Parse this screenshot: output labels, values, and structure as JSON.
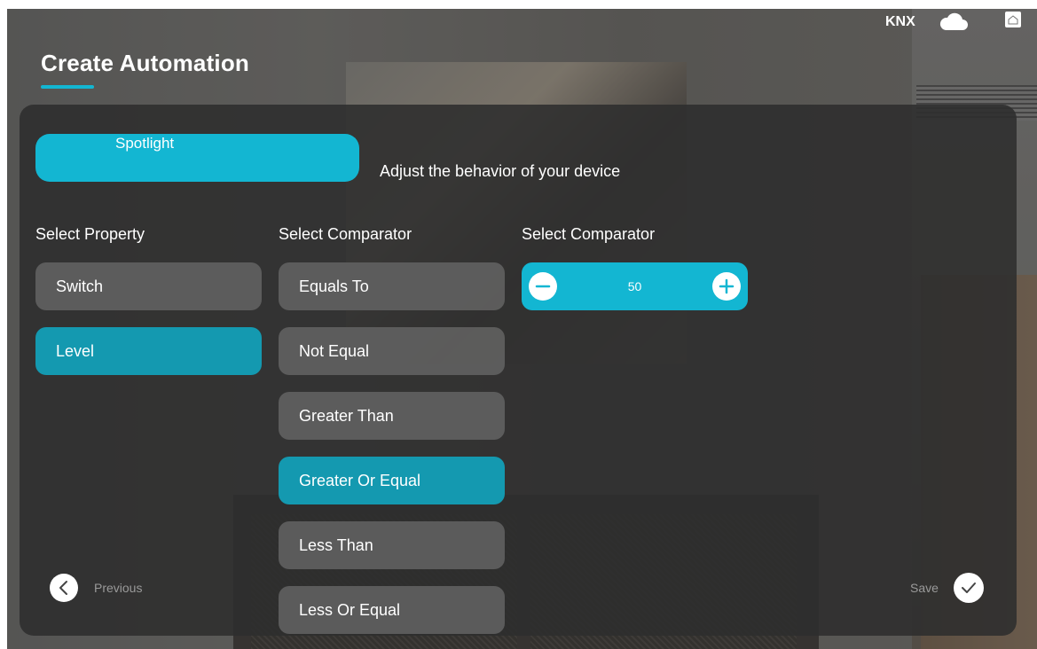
{
  "topbar": {
    "knx_label": "KNX",
    "icons": [
      "cloud-icon",
      "home-icon"
    ]
  },
  "page": {
    "title": "Create Automation"
  },
  "device": {
    "name": "Spotlight",
    "subtitle": "Adjust the behavior of your device"
  },
  "columns": {
    "property_label": "Select Property",
    "comparator_label": "Select Comparator",
    "value_label": "Select Comparator"
  },
  "properties": [
    {
      "label": "Switch",
      "selected": false
    },
    {
      "label": "Level",
      "selected": true
    }
  ],
  "comparators": [
    {
      "label": "Equals To",
      "selected": false
    },
    {
      "label": "Not Equal",
      "selected": false
    },
    {
      "label": "Greater Than",
      "selected": false
    },
    {
      "label": "Greater Or Equal",
      "selected": true
    },
    {
      "label": "Less Than",
      "selected": false
    },
    {
      "label": "Less Or Equal",
      "selected": false
    }
  ],
  "stepper": {
    "value": "50",
    "icons": [
      "minus-icon",
      "plus-icon"
    ]
  },
  "footer": {
    "previous_label": "Previous",
    "save_label": "Save"
  },
  "colors": {
    "accent": "#13b6d2",
    "selected": "#1499b0",
    "panel": "#2e2e2e",
    "option": "#5f5f5f"
  }
}
